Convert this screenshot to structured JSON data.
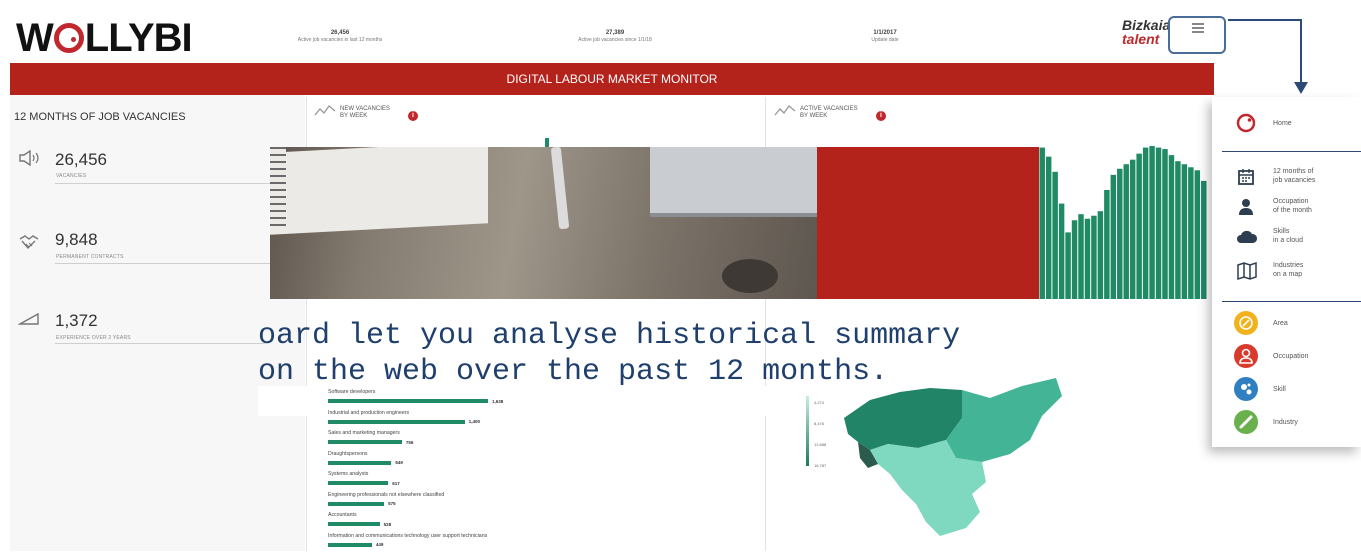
{
  "header": {
    "logo_pre": "W",
    "logo_post": "LLYBI",
    "stats": [
      {
        "value": "26,456",
        "label": "Active job vacancies in last 12 months"
      },
      {
        "value": "27,389",
        "label": "Active job vacancies since 1/1/18"
      },
      {
        "value": "1/1/2017",
        "label": "Update date"
      }
    ],
    "brand_line1": "Bizkaia",
    "brand_line2": "talent",
    "menu_icon": "hamburger-icon"
  },
  "title_bar": "DIGITAL LABOUR MARKET MONITOR",
  "left_panel": {
    "title": "12 MONTHS OF JOB VACANCIES",
    "kpis": [
      {
        "icon": "megaphone-icon",
        "value": "26,456",
        "label": "VACANCIES"
      },
      {
        "icon": "handshake-icon",
        "value": "9,848",
        "label": "PERMANENT CONTRACTS"
      },
      {
        "icon": "stairs-icon",
        "value": "1,372",
        "label": "EXPERIENCE OVER 2 YEARS"
      }
    ]
  },
  "panels": {
    "new_vacancies": {
      "title_line1": "NEW VACANCIES",
      "title_line2": "BY WEEK"
    },
    "active_vacancies": {
      "title_line1": "ACTIVE VACANCIES",
      "title_line2": "BY WEEK"
    }
  },
  "overlay_text": {
    "line1": "oard let you analyse historical summary",
    "line2": "on the web over the past 12 months."
  },
  "chart_data": [
    {
      "type": "bar",
      "categories": [
        "Software developers",
        "Industrial and production engineers",
        "Sales and marketing managers",
        "Draughtspersons",
        "Systems analysts",
        "Engineering professionals not elsewhere classified",
        "Accountants",
        "Information and communications technology user support technicians"
      ],
      "values": [
        1638,
        1400,
        756,
        649,
        617,
        575,
        528,
        449
      ],
      "data_labels": [
        "1,638",
        "1,400",
        "756",
        "649",
        "617",
        "575",
        "528",
        "449"
      ]
    },
    {
      "type": "bar",
      "categories": [
        "",
        "",
        "",
        "",
        "",
        "",
        "",
        "",
        "",
        "",
        "",
        "",
        "",
        "",
        "",
        "",
        "",
        "",
        "",
        "",
        "",
        "",
        "",
        "",
        "",
        ""
      ],
      "values": [
        100,
        94,
        84,
        63,
        44,
        52,
        56,
        53,
        55,
        58,
        72,
        82,
        86,
        89,
        92,
        96,
        100,
        101,
        100,
        99,
        95,
        91,
        89,
        87,
        85,
        78
      ],
      "ylim": [
        0,
        105
      ]
    }
  ],
  "legend": {
    "labels": [
      "4,274",
      "8,476",
      "12,688",
      "16,787"
    ]
  },
  "menu": {
    "items": [
      {
        "icon": "home-icon",
        "label": "Home",
        "color": "#c0282d"
      },
      {
        "icon": "calendar-icon",
        "label": "12 months of\njob vacancies",
        "color": "#2d3e50"
      },
      {
        "icon": "person-icon",
        "label": "Occupation\nof the month",
        "color": "#2d3e50"
      },
      {
        "icon": "cloud-icon",
        "label": "Skills\nin a cloud",
        "color": "#2d3e50"
      },
      {
        "icon": "map-icon",
        "label": "Industries\non a map",
        "color": "#2d3e50"
      },
      {
        "icon": "area-icon",
        "label": "Area",
        "color": "#f2b21b"
      },
      {
        "icon": "occupation-icon",
        "label": "Occupation",
        "color": "#d93a2b"
      },
      {
        "icon": "skill-icon",
        "label": "Skill",
        "color": "#2f7fc1"
      },
      {
        "icon": "industry-icon",
        "label": "Industry",
        "color": "#6ab04c"
      }
    ]
  },
  "colors": {
    "accent_red": "#b4221c",
    "bar_green": "#1f8a63",
    "map_light": "#7fd8c0",
    "map_mid": "#43b596",
    "map_dark": "#218467"
  }
}
